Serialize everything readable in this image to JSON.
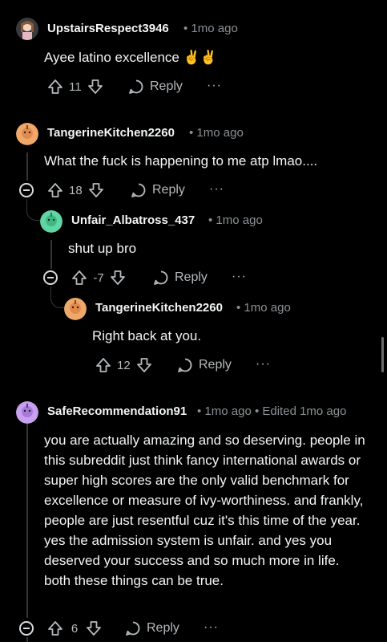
{
  "comments": [
    {
      "username": "UpstairsRespect3946",
      "time": "• 1mo ago",
      "body": "Ayee latino excellence ✌️✌️",
      "votes": "11",
      "reply_label": "Reply",
      "more_label": "···"
    },
    {
      "username": "TangerineKitchen2260",
      "time": "• 1mo ago",
      "body": "What the fuck is happening to me atp lmao....",
      "votes": "18",
      "reply_label": "Reply",
      "more_label": "···"
    },
    {
      "username": "Unfair_Albatross_437",
      "time": "• 1mo ago",
      "body": "shut up bro",
      "votes": "-7",
      "reply_label": "Reply",
      "more_label": "···"
    },
    {
      "username": "TangerineKitchen2260",
      "time": "• 1mo ago",
      "body": "Right back at you.",
      "votes": "12",
      "reply_label": "Reply",
      "more_label": "···"
    },
    {
      "username": "SafeRecommendation91",
      "time": "• 1mo ago • Edited 1mo ago",
      "body": "you are actually amazing and so deserving. people in this subreddit just think fancy international awards or super high scores are the only valid benchmark for excellence or measure of ivy-worthiness. and frankly, people are just resentful cuz it's this time of the year. yes the admission system is unfair. and yes you deserved your success and so much more in life. both these things can be true.",
      "votes": "6",
      "reply_label": "Reply",
      "more_label": "···"
    }
  ],
  "colors": {
    "background": "#000000",
    "avatar_orange": "#f0a86a",
    "avatar_green": "#5fd6a4",
    "avatar_purple": "#c7a0f0",
    "avatar_pink": "#e6b8c4"
  }
}
